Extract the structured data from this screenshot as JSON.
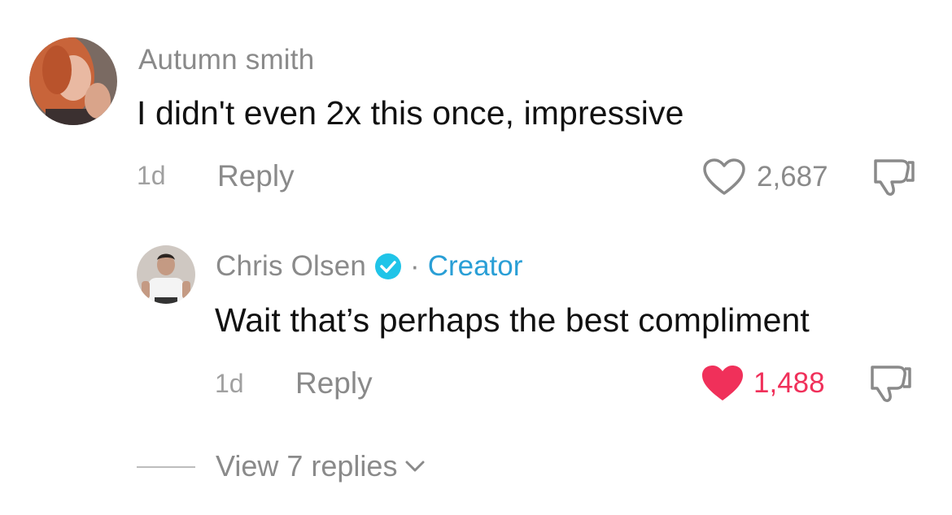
{
  "comments": [
    {
      "username": "Autumn smith",
      "text": "I didn't even 2x this once, impressive",
      "time": "1d",
      "reply_label": "Reply",
      "likes": "2,687",
      "liked": false,
      "avatar_icon": "avatar-photo-autumn"
    }
  ],
  "reply": {
    "username": "Chris Olsen",
    "verified_icon": "verified-badge-icon",
    "separator": "·",
    "creator_label": "Creator",
    "text": "Wait that’s perhaps the best compliment",
    "time": "1d",
    "reply_label": "Reply",
    "likes": "1,488",
    "liked": true,
    "avatar_icon": "avatar-photo-chris"
  },
  "view_replies": {
    "label": "View 7 replies",
    "icon": "chevron-down-icon"
  },
  "colors": {
    "like_active": "#f0305a",
    "creator": "#2a9fd6",
    "muted": "#8a8a8a",
    "text": "#111111"
  }
}
